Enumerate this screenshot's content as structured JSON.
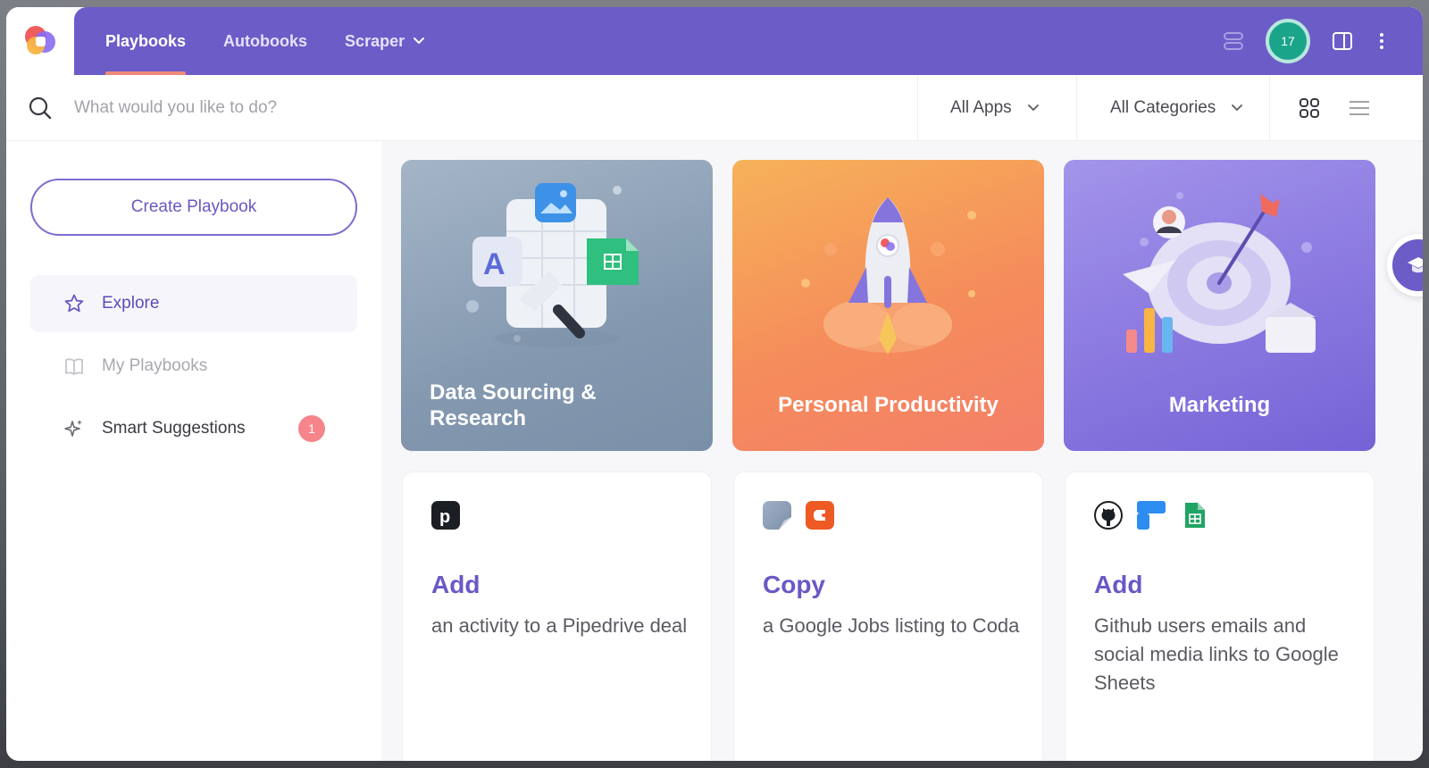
{
  "nav": {
    "tabs": [
      {
        "label": "Playbooks"
      },
      {
        "label": "Autobooks"
      },
      {
        "label": "Scraper"
      }
    ],
    "notification_count": "17"
  },
  "search": {
    "placeholder": "What would you like to do?",
    "apps_filter": "All Apps",
    "categories_filter": "All Categories"
  },
  "sidebar": {
    "create_label": "Create Playbook",
    "items": [
      {
        "label": "Explore",
        "icon": "star-icon"
      },
      {
        "label": "My Playbooks",
        "icon": "book-icon"
      },
      {
        "label": "Smart Suggestions",
        "icon": "sparkle-icon",
        "badge": "1"
      }
    ]
  },
  "categories": [
    {
      "title": "Data Sourcing & Research",
      "color": "#8ea2b6"
    },
    {
      "title": "Personal Productivity",
      "color": "#f58a5c"
    },
    {
      "title": "Marketing",
      "color": "#8b7ae0"
    }
  ],
  "playbooks": [
    {
      "verb": "Add",
      "description": "an activity to a Pipedrive deal",
      "apps": [
        "pipedrive-icon"
      ]
    },
    {
      "verb": "Copy",
      "description": "a Google Jobs listing to Coda",
      "apps": [
        "google-jobs-icon",
        "coda-icon"
      ]
    },
    {
      "verb": "Add",
      "description": "Github users emails and social media links to Google Sheets",
      "apps": [
        "github-icon",
        "framer-icon",
        "google-sheets-icon"
      ]
    }
  ],
  "colors": {
    "brand": "#6c5cc8",
    "accent": "#f08a78",
    "badge": "#f5858a"
  }
}
